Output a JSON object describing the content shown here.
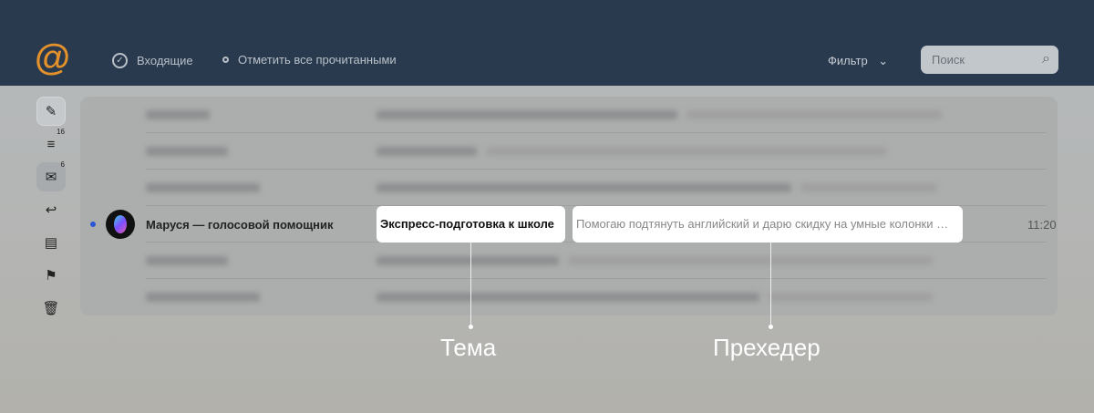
{
  "header": {
    "inbox": "Входящие",
    "mark_all_read": "Отметить все прочитанными",
    "filter": "Фильтр",
    "search_placeholder": "Поиск"
  },
  "sidebar": {
    "all_count": "16",
    "inbox_count": "6"
  },
  "message": {
    "sender": "Маруся — голосовой помощник",
    "subject": "Экспресс-подготовка к школе",
    "preheader": "Помогаю подтянуть английский и дарю скидку на умные колонки …",
    "time": "11:20"
  },
  "annotations": {
    "subject_label": "Тема",
    "preheader_label": "Прехедер"
  }
}
